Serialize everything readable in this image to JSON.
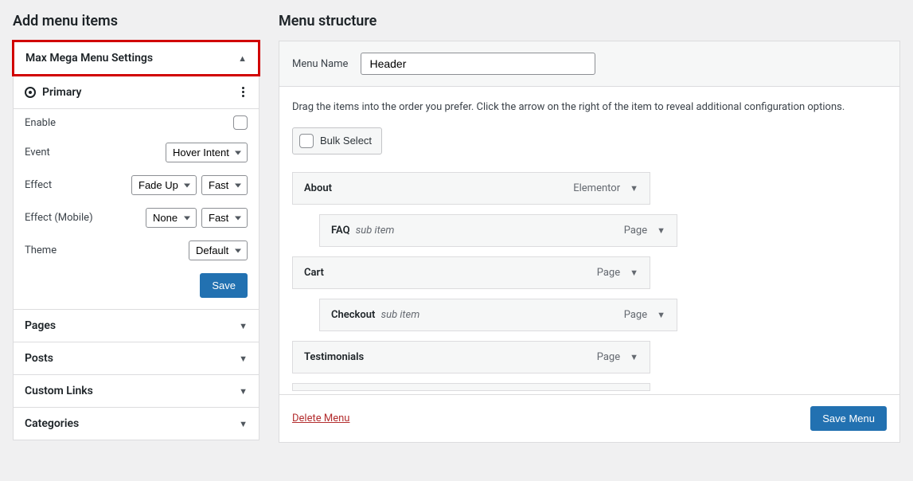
{
  "left": {
    "title": "Add menu items",
    "mmenu": {
      "header": "Max Mega Menu Settings",
      "location_label": "Primary",
      "rows": {
        "enable": "Enable",
        "event_label": "Event",
        "event_value": "Hover Intent",
        "effect_label": "Effect",
        "effect_value": "Fade Up",
        "effect_speed": "Fast",
        "effect_mobile_label": "Effect (Mobile)",
        "effect_mobile_value": "None",
        "effect_mobile_speed": "Fast",
        "theme_label": "Theme",
        "theme_value": "Default"
      },
      "save_button": "Save"
    },
    "accordions": {
      "pages": "Pages",
      "posts": "Posts",
      "custom_links": "Custom Links",
      "categories": "Categories"
    }
  },
  "right": {
    "title": "Menu structure",
    "menu_name_label": "Menu Name",
    "menu_name_value": "Header",
    "instructions": "Drag the items into the order you prefer. Click the arrow on the right of the item to reveal additional configuration options.",
    "bulk_select": "Bulk Select",
    "items": [
      {
        "title": "About",
        "type": "Elementor",
        "depth": 0,
        "sub": false
      },
      {
        "title": "FAQ",
        "type": "Page",
        "depth": 1,
        "sub": true
      },
      {
        "title": "Cart",
        "type": "Page",
        "depth": 0,
        "sub": false
      },
      {
        "title": "Checkout",
        "type": "Page",
        "depth": 1,
        "sub": true
      },
      {
        "title": "Testimonials",
        "type": "Page",
        "depth": 0,
        "sub": false
      }
    ],
    "sub_item_tag": "sub item",
    "delete_menu": "Delete Menu",
    "save_menu": "Save Menu"
  }
}
